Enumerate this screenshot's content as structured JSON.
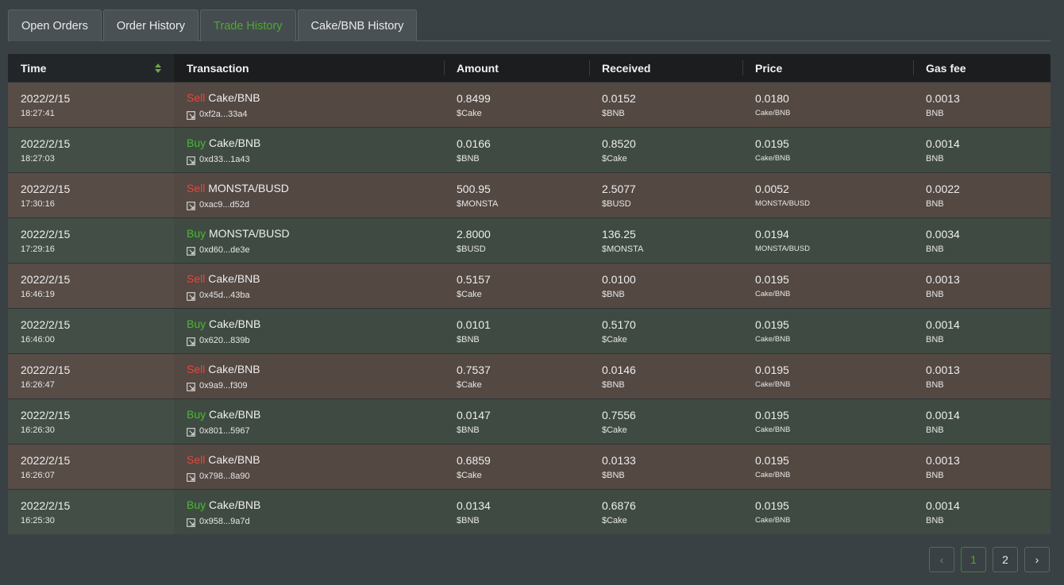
{
  "tabs": [
    {
      "label": "Open Orders",
      "name": "tab-open-orders",
      "active": false
    },
    {
      "label": "Order History",
      "name": "tab-order-history",
      "active": false
    },
    {
      "label": "Trade History",
      "name": "tab-trade-history",
      "active": true
    },
    {
      "label": "Cake/BNB History",
      "name": "tab-cake-bnb-history",
      "active": false
    }
  ],
  "columns": {
    "time": "Time",
    "transaction": "Transaction",
    "amount": "Amount",
    "received": "Received",
    "price": "Price",
    "gas_fee": "Gas fee"
  },
  "rows": [
    {
      "date": "2022/2/15",
      "time": "18:27:41",
      "side": "Sell",
      "type": "sell",
      "pair": "Cake/BNB",
      "tx": "0xf2a...33a4",
      "amount": "0.8499",
      "amount_unit": "$Cake",
      "received": "0.0152",
      "received_unit": "$BNB",
      "price": "0.0180",
      "price_unit": "Cake/BNB",
      "gas": "0.0013",
      "gas_unit": "BNB"
    },
    {
      "date": "2022/2/15",
      "time": "18:27:03",
      "side": "Buy",
      "type": "buy",
      "pair": "Cake/BNB",
      "tx": "0xd33...1a43",
      "amount": "0.0166",
      "amount_unit": "$BNB",
      "received": "0.8520",
      "received_unit": "$Cake",
      "price": "0.0195",
      "price_unit": "Cake/BNB",
      "gas": "0.0014",
      "gas_unit": "BNB"
    },
    {
      "date": "2022/2/15",
      "time": "17:30:16",
      "side": "Sell",
      "type": "sell",
      "pair": "MONSTA/BUSD",
      "tx": "0xac9...d52d",
      "amount": "500.95",
      "amount_unit": "$MONSTA",
      "received": "2.5077",
      "received_unit": "$BUSD",
      "price": "0.0052",
      "price_unit": "MONSTA/BUSD",
      "gas": "0.0022",
      "gas_unit": "BNB"
    },
    {
      "date": "2022/2/15",
      "time": "17:29:16",
      "side": "Buy",
      "type": "buy",
      "pair": "MONSTA/BUSD",
      "tx": "0xd60...de3e",
      "amount": "2.8000",
      "amount_unit": "$BUSD",
      "received": "136.25",
      "received_unit": "$MONSTA",
      "price": "0.0194",
      "price_unit": "MONSTA/BUSD",
      "gas": "0.0034",
      "gas_unit": "BNB"
    },
    {
      "date": "2022/2/15",
      "time": "16:46:19",
      "side": "Sell",
      "type": "sell",
      "pair": "Cake/BNB",
      "tx": "0x45d...43ba",
      "amount": "0.5157",
      "amount_unit": "$Cake",
      "received": "0.0100",
      "received_unit": "$BNB",
      "price": "0.0195",
      "price_unit": "Cake/BNB",
      "gas": "0.0013",
      "gas_unit": "BNB"
    },
    {
      "date": "2022/2/15",
      "time": "16:46:00",
      "side": "Buy",
      "type": "buy",
      "pair": "Cake/BNB",
      "tx": "0x620...839b",
      "amount": "0.0101",
      "amount_unit": "$BNB",
      "received": "0.5170",
      "received_unit": "$Cake",
      "price": "0.0195",
      "price_unit": "Cake/BNB",
      "gas": "0.0014",
      "gas_unit": "BNB"
    },
    {
      "date": "2022/2/15",
      "time": "16:26:47",
      "side": "Sell",
      "type": "sell",
      "pair": "Cake/BNB",
      "tx": "0x9a9...f309",
      "amount": "0.7537",
      "amount_unit": "$Cake",
      "received": "0.0146",
      "received_unit": "$BNB",
      "price": "0.0195",
      "price_unit": "Cake/BNB",
      "gas": "0.0013",
      "gas_unit": "BNB"
    },
    {
      "date": "2022/2/15",
      "time": "16:26:30",
      "side": "Buy",
      "type": "buy",
      "pair": "Cake/BNB",
      "tx": "0x801...5967",
      "amount": "0.0147",
      "amount_unit": "$BNB",
      "received": "0.7556",
      "received_unit": "$Cake",
      "price": "0.0195",
      "price_unit": "Cake/BNB",
      "gas": "0.0014",
      "gas_unit": "BNB"
    },
    {
      "date": "2022/2/15",
      "time": "16:26:07",
      "side": "Sell",
      "type": "sell",
      "pair": "Cake/BNB",
      "tx": "0x798...8a90",
      "amount": "0.6859",
      "amount_unit": "$Cake",
      "received": "0.0133",
      "received_unit": "$BNB",
      "price": "0.0195",
      "price_unit": "Cake/BNB",
      "gas": "0.0013",
      "gas_unit": "BNB"
    },
    {
      "date": "2022/2/15",
      "time": "16:25:30",
      "side": "Buy",
      "type": "buy",
      "pair": "Cake/BNB",
      "tx": "0x958...9a7d",
      "amount": "0.0134",
      "amount_unit": "$BNB",
      "received": "0.6876",
      "received_unit": "$Cake",
      "price": "0.0195",
      "price_unit": "Cake/BNB",
      "gas": "0.0014",
      "gas_unit": "BNB"
    }
  ],
  "pagination": {
    "prev": "‹",
    "pages": [
      "1",
      "2"
    ],
    "current": "1",
    "next": "›"
  },
  "colors": {
    "sell": "#e8463a",
    "buy": "#4cb830",
    "accent": "#4ea832"
  }
}
